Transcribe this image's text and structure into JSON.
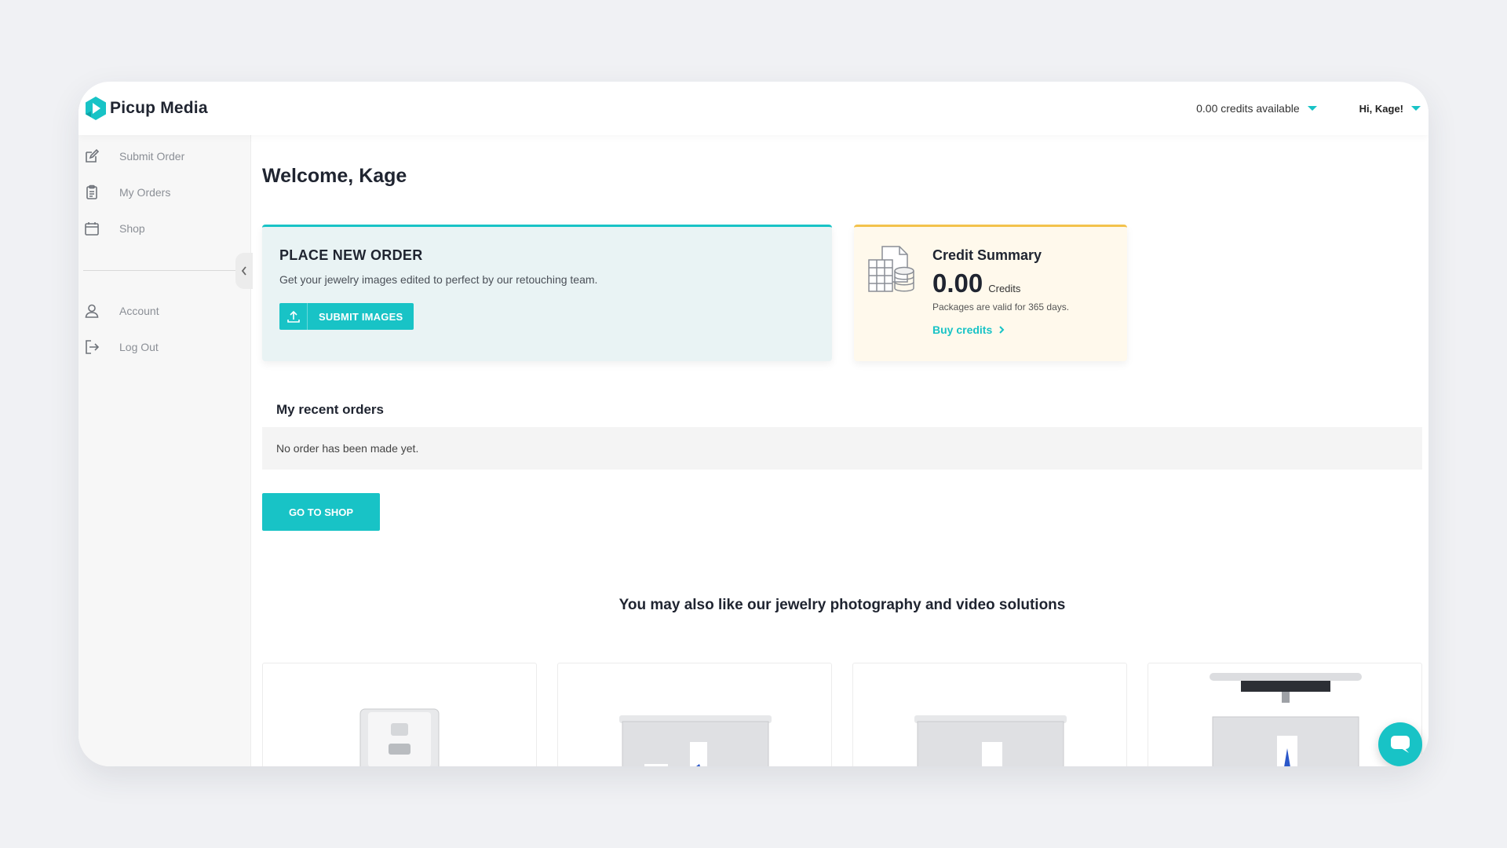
{
  "brand": {
    "name": "Picup Media",
    "accent": "#18c3c6",
    "warning": "#f3c24b"
  },
  "header": {
    "credits_label": "0.00 credits available",
    "user_label": "Hi, Kage!"
  },
  "sidebar": {
    "items": [
      {
        "label": "Submit Order",
        "icon": "edit-icon"
      },
      {
        "label": "My Orders",
        "icon": "clipboard-icon"
      },
      {
        "label": "Shop",
        "icon": "shop-icon"
      }
    ],
    "account_items": [
      {
        "label": "Account",
        "icon": "user-icon"
      },
      {
        "label": "Log Out",
        "icon": "logout-icon"
      }
    ]
  },
  "main": {
    "welcome": "Welcome, Kage",
    "order_card": {
      "title": "PLACE NEW ORDER",
      "description": "Get your jewelry images edited to perfect by our retouching team.",
      "button_label": "SUBMIT IMAGES"
    },
    "credit_card": {
      "title": "Credit Summary",
      "amount": "0.00",
      "unit": "Credits",
      "note": "Packages are valid for 365 days.",
      "link_label": "Buy credits"
    },
    "recent_orders": {
      "title": "My recent orders",
      "empty_text": "No order has been made yet."
    },
    "shop_button": "GO TO SHOP",
    "also_like": "You may also like our jewelry photography and video solutions",
    "products": [
      {
        "icon": "turntable-device-icon"
      },
      {
        "icon": "photo-booth-icon"
      },
      {
        "icon": "photo-booth-icon"
      },
      {
        "icon": "photo-booth-overhead-icon"
      }
    ]
  }
}
